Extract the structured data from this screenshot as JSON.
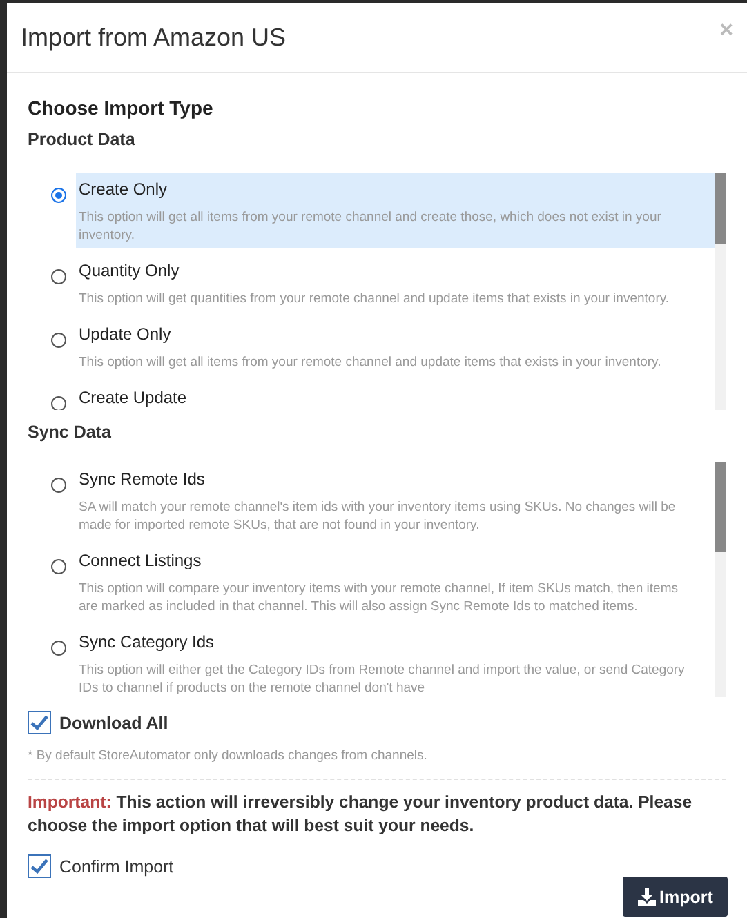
{
  "dialog": {
    "title": "Import from Amazon US",
    "close": "×"
  },
  "heading": "Choose Import Type",
  "product_data": {
    "label": "Product Data",
    "options": [
      {
        "label": "Create Only",
        "description": "This option will get all items from your remote channel and create those, which does not exist in your inventory.",
        "selected": true
      },
      {
        "label": "Quantity Only",
        "description": "This option will get quantities from your remote channel and update items that exists in your inventory.",
        "selected": false
      },
      {
        "label": "Update Only",
        "description": "This option will get all items from your remote channel and update items that exists in your inventory.",
        "selected": false
      },
      {
        "label": "Create Update",
        "selected": false
      }
    ]
  },
  "sync_data": {
    "label": "Sync Data",
    "options": [
      {
        "label": "Sync Remote Ids",
        "description": "SA will match your remote channel's item ids with your inventory items using SKUs. No changes will be made for imported remote SKUs, that are not found in your inventory.",
        "selected": false
      },
      {
        "label": "Connect Listings",
        "description": "This option will compare your inventory items with your remote channel, If item SKUs match, then items are marked as included in that channel. This will also assign Sync Remote Ids to matched items.",
        "selected": false
      },
      {
        "label": "Sync Category Ids",
        "description": "This option will either get the Category IDs from Remote channel and import the value, or send Category IDs to channel if products on the remote channel don't have",
        "selected": false
      }
    ]
  },
  "download_all": {
    "label": "Download All",
    "checked": true
  },
  "note": "* By default StoreAutomator only downloads changes from channels.",
  "warning": "**Important:** This action will irreversibly change your inventory product data. Please choose the import option that will best suit your needs.",
  "confirm_import": {
    "label": "Confirm Import",
    "checked": true
  },
  "import_button": "Import"
}
